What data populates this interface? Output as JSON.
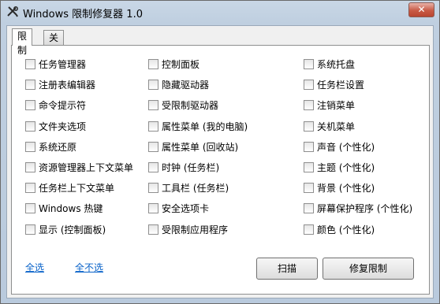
{
  "window": {
    "title": "Windows 限制修复器 1.0",
    "close_label": "✕"
  },
  "tabs": [
    {
      "label": "限制"
    },
    {
      "label": "关于"
    }
  ],
  "columns": [
    {
      "items": [
        {
          "label": "任务管理器",
          "checked": false
        },
        {
          "label": "注册表编辑器",
          "checked": false
        },
        {
          "label": "命令提示符",
          "checked": false
        },
        {
          "label": "文件夹选项",
          "checked": false
        },
        {
          "label": "系统还原",
          "checked": false
        },
        {
          "label": "资源管理器上下文菜单",
          "checked": false
        },
        {
          "label": "任务栏上下文菜单",
          "checked": false
        },
        {
          "label": "Windows 热键",
          "checked": false
        },
        {
          "label": "显示 (控制面板)",
          "checked": false
        }
      ]
    },
    {
      "items": [
        {
          "label": "控制面板",
          "checked": false
        },
        {
          "label": "隐藏驱动器",
          "checked": false
        },
        {
          "label": "受限制驱动器",
          "checked": false
        },
        {
          "label": "属性菜单 (我的电脑)",
          "checked": false
        },
        {
          "label": "属性菜单 (回收站)",
          "checked": false
        },
        {
          "label": "时钟 (任务栏)",
          "checked": false
        },
        {
          "label": "工具栏 (任务栏)",
          "checked": false
        },
        {
          "label": "安全选项卡",
          "checked": false
        },
        {
          "label": "受限制应用程序",
          "checked": false
        }
      ]
    },
    {
      "items": [
        {
          "label": "系统托盘",
          "checked": false
        },
        {
          "label": "任务栏设置",
          "checked": false
        },
        {
          "label": "注销菜单",
          "checked": false
        },
        {
          "label": "关机菜单",
          "checked": false
        },
        {
          "label": "声音 (个性化)",
          "checked": false
        },
        {
          "label": "主题 (个性化)",
          "checked": false
        },
        {
          "label": "背景 (个性化)",
          "checked": false
        },
        {
          "label": "屏幕保护程序 (个性化)",
          "checked": false
        },
        {
          "label": "颜色 (个性化)",
          "checked": false
        }
      ]
    }
  ],
  "footer": {
    "select_all": "全选",
    "select_none": "全不选",
    "scan": "扫描",
    "repair": "修复限制"
  },
  "colors": {
    "link": "#0a63c9",
    "frame": "#bfcfe0",
    "close": "#c85a45"
  }
}
